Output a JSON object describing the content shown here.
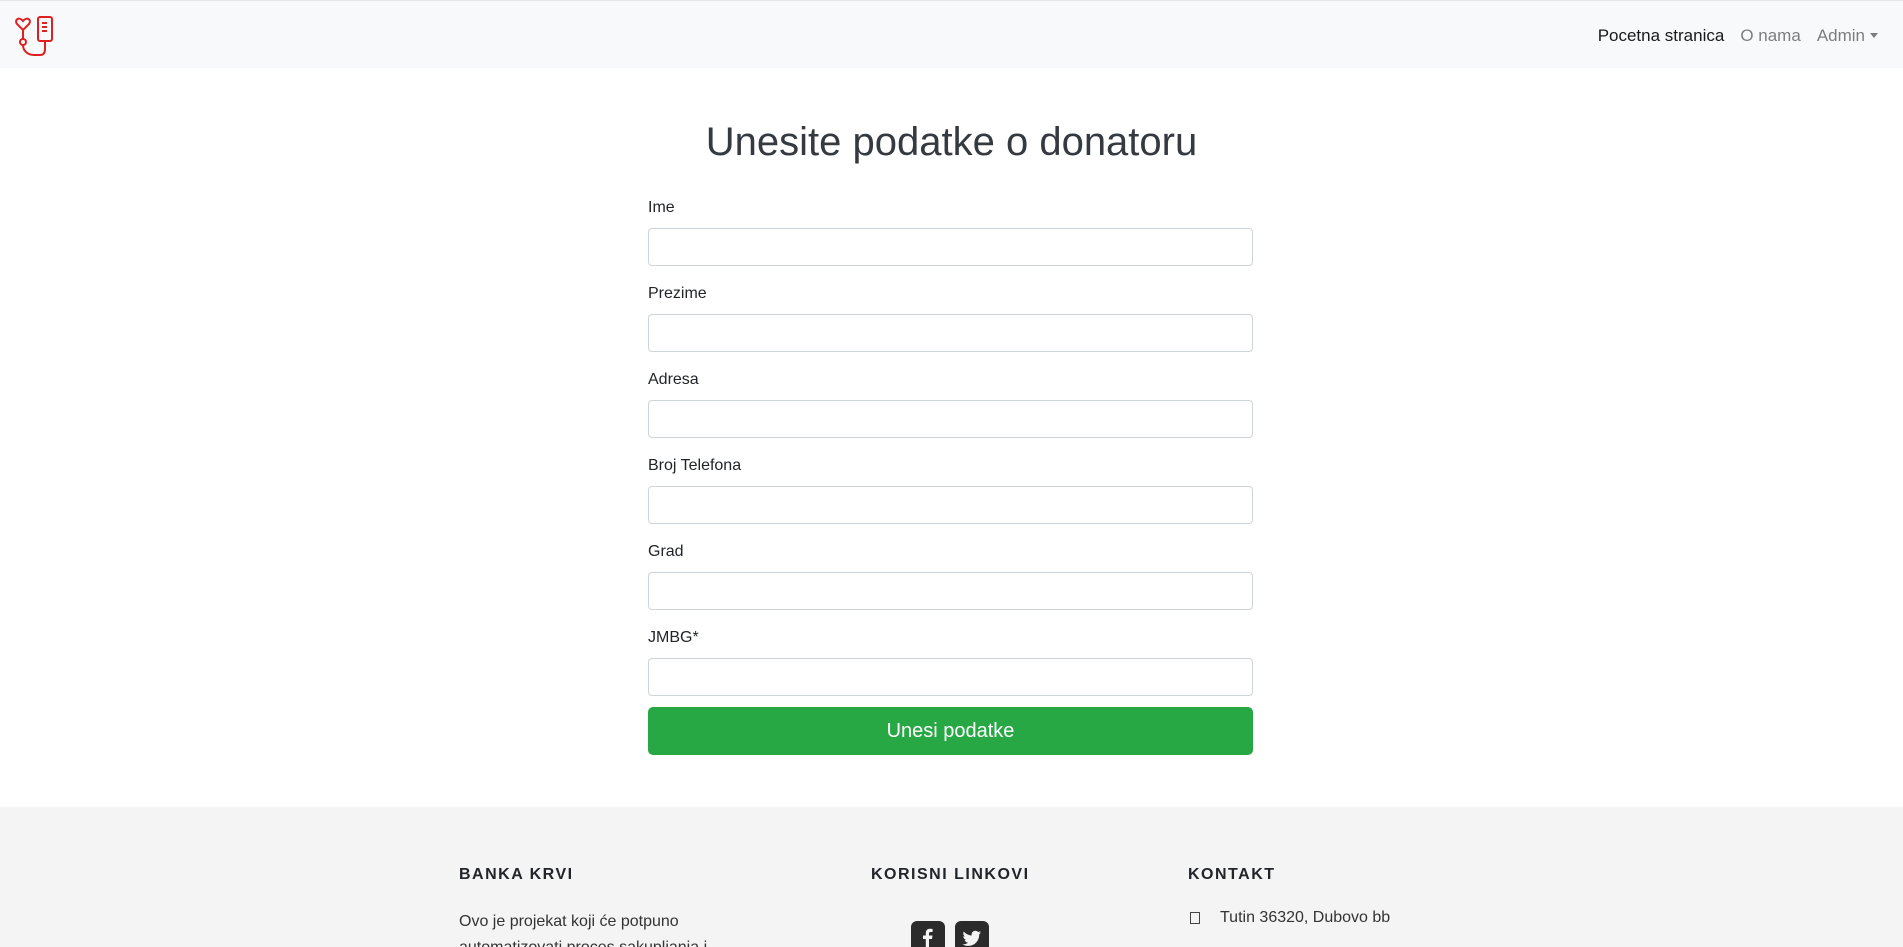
{
  "navbar": {
    "links": [
      {
        "label": "Pocetna stranica",
        "active": true
      },
      {
        "label": "O nama",
        "active": false
      },
      {
        "label": "Admin",
        "active": false,
        "dropdown": true
      }
    ],
    "logo_icon": "blood-bag-stethoscope-icon",
    "logo_color": "#e02020"
  },
  "form": {
    "title": "Unesite podatke o donatoru",
    "fields": [
      {
        "label": "Ime",
        "value": "",
        "placeholder": ""
      },
      {
        "label": "Prezime",
        "value": "",
        "placeholder": ""
      },
      {
        "label": "Adresa",
        "value": "",
        "placeholder": ""
      },
      {
        "label": "Broj Telefona",
        "value": "",
        "placeholder": ""
      },
      {
        "label": "Grad",
        "value": "",
        "placeholder": ""
      },
      {
        "label": "JMBG*",
        "value": "",
        "placeholder": ""
      }
    ],
    "submit_label": "Unesi podatke",
    "submit_color": "#28a745"
  },
  "footer": {
    "about": {
      "heading": "BANKA KRVI",
      "text": "Ovo je projekat koji će potpuno automatizovati proces sakupljanja i"
    },
    "links": {
      "heading": "KORISNI LINKOVI",
      "icons": [
        "facebook-icon",
        "twitter-icon"
      ]
    },
    "contact": {
      "heading": "KONTAKT",
      "address": "Tutin 36320, Dubovo bb",
      "address_icon": "map-marker-icon"
    }
  }
}
